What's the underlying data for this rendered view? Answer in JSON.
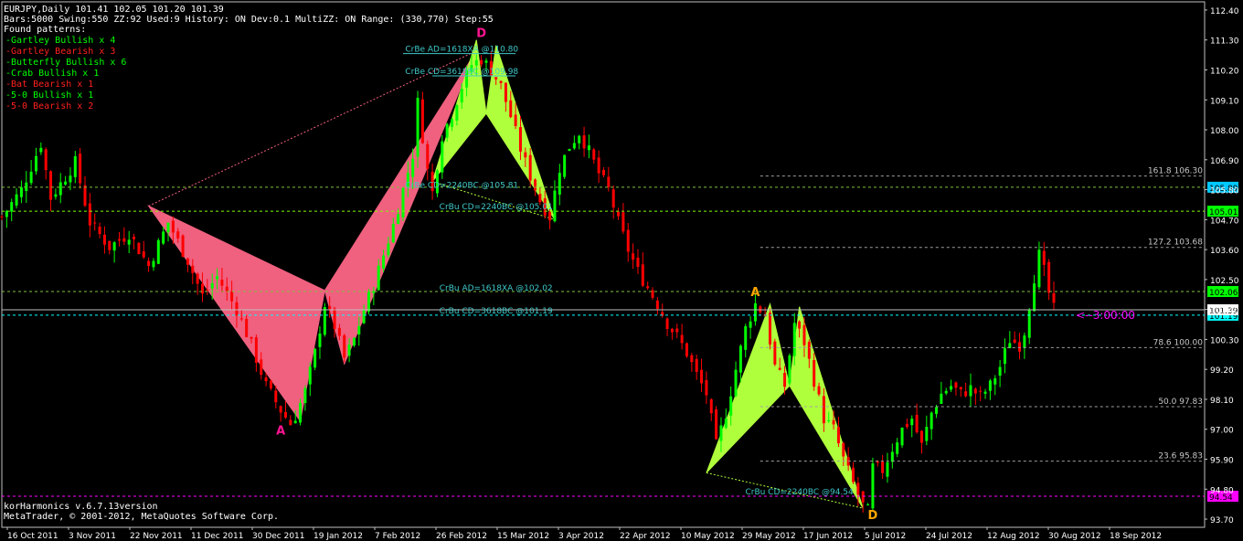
{
  "header": {
    "line1": "EURJPY,Daily  101.41 102.05 101.20 101.39",
    "line2": "Bars:5000  Swing:550  ZZ:92  Used:9  History: ON Dev:0.1  MultiZZ: ON  Range: (330,770)  Step:55",
    "found_label": "Found patterns:",
    "patterns": [
      {
        "text": "-Gartley Bullish x 4",
        "color": "#00ff00"
      },
      {
        "text": "-Gartley Bearish x 3",
        "color": "#ff2020"
      },
      {
        "text": "-Butterfly Bullish x 6",
        "color": "#00ff00"
      },
      {
        "text": "-Crab Bullish x 1",
        "color": "#00ff00"
      },
      {
        "text": "-Bat Bearish x 1",
        "color": "#ff2020"
      },
      {
        "text": "-5-0 Bullish x 1",
        "color": "#00ff00"
      },
      {
        "text": "-5-0 Bearish x 2",
        "color": "#ff2020"
      }
    ]
  },
  "footer": {
    "version": "korHarmonics v.6.7.13version",
    "copyright": "MetaTrader, © 2001-2012, MetaQuotes Software Corp."
  },
  "chart_data": {
    "type": "candlestick",
    "symbol": "EURJPY",
    "timeframe": "Daily",
    "y_ticks": [
      112.4,
      111.3,
      110.2,
      109.1,
      108.0,
      106.9,
      105.8,
      104.7,
      103.6,
      102.5,
      101.4,
      100.3,
      99.2,
      98.1,
      97.0,
      95.9,
      94.8,
      93.7
    ],
    "ylim": [
      93.4,
      112.7
    ],
    "x_ticks": [
      "16 Oct 2011",
      "3 Nov 2011",
      "22 Nov 2011",
      "11 Dec 2011",
      "30 Dec 2011",
      "19 Jan 2012",
      "7 Feb 2012",
      "26 Feb 2012",
      "15 Mar 2012",
      "3 Apr 2012",
      "22 Apr 2012",
      "10 May 2012",
      "29 May 2012",
      "17 Jun 2012",
      "5 Jul 2012",
      "24 Jul 2012",
      "12 Aug 2012",
      "30 Aug 2012",
      "18 Sep 2012"
    ],
    "close_path": [
      [
        0,
        104.8
      ],
      [
        4,
        105.8
      ],
      [
        8,
        107.5
      ],
      [
        10,
        105.5
      ],
      [
        15,
        106.8
      ],
      [
        18,
        104.6
      ],
      [
        22,
        103.7
      ],
      [
        26,
        104.2
      ],
      [
        30,
        103.0
      ],
      [
        34,
        104.6
      ],
      [
        38,
        103.2
      ],
      [
        41,
        101.9
      ],
      [
        44,
        102.6
      ],
      [
        48,
        101.4
      ],
      [
        51,
        100.1
      ],
      [
        54,
        98.6
      ],
      [
        57,
        97.7
      ],
      [
        59,
        97.2
      ],
      [
        60,
        97.5
      ],
      [
        62,
        98.4
      ],
      [
        64,
        99.8
      ],
      [
        66,
        101.6
      ],
      [
        68,
        100.8
      ],
      [
        70,
        99.6
      ],
      [
        72,
        100.3
      ],
      [
        74,
        101.4
      ],
      [
        76,
        102.3
      ],
      [
        78,
        103.4
      ],
      [
        80,
        104.5
      ],
      [
        82,
        105.8
      ],
      [
        84,
        107.1
      ],
      [
        85,
        109.0
      ],
      [
        87,
        106.5
      ],
      [
        88,
        105.7
      ],
      [
        90,
        107.8
      ],
      [
        92,
        108.6
      ],
      [
        94,
        109.6
      ],
      [
        96,
        110.4
      ],
      [
        98,
        110.6
      ],
      [
        100,
        110.2
      ],
      [
        102,
        109.6
      ],
      [
        104,
        108.5
      ],
      [
        106,
        107.3
      ],
      [
        108,
        106.3
      ],
      [
        110,
        105.4
      ],
      [
        112,
        104.8
      ],
      [
        114,
        106.6
      ],
      [
        116,
        107.4
      ],
      [
        118,
        107.9
      ],
      [
        120,
        107.2
      ],
      [
        122,
        106.4
      ],
      [
        124,
        105.8
      ],
      [
        126,
        104.6
      ],
      [
        128,
        103.6
      ],
      [
        130,
        102.8
      ],
      [
        132,
        102.2
      ],
      [
        134,
        101.6
      ],
      [
        136,
        100.9
      ],
      [
        138,
        100.4
      ],
      [
        140,
        99.8
      ],
      [
        142,
        99.0
      ],
      [
        144,
        98.3
      ],
      [
        146,
        96.4
      ],
      [
        148,
        97.6
      ],
      [
        150,
        99.2
      ],
      [
        152,
        100.7
      ],
      [
        154,
        101.6
      ],
      [
        156,
        101.2
      ],
      [
        158,
        99.3
      ],
      [
        160,
        98.6
      ],
      [
        162,
        100.9
      ],
      [
        164,
        100.2
      ],
      [
        166,
        98.8
      ],
      [
        168,
        97.4
      ],
      [
        170,
        97.0
      ],
      [
        172,
        95.9
      ],
      [
        174,
        95.0
      ],
      [
        176,
        94.2
      ],
      [
        177,
        94.0
      ],
      [
        178,
        95.6
      ],
      [
        180,
        95.5
      ],
      [
        182,
        96.3
      ],
      [
        184,
        97.0
      ],
      [
        186,
        97.4
      ],
      [
        188,
        96.4
      ],
      [
        190,
        97.6
      ],
      [
        192,
        98.3
      ],
      [
        194,
        98.6
      ],
      [
        196,
        98.3
      ],
      [
        198,
        98.5
      ],
      [
        200,
        98.2
      ],
      [
        202,
        98.6
      ],
      [
        204,
        99.3
      ],
      [
        206,
        100.3
      ],
      [
        208,
        100.1
      ],
      [
        209,
        100.6
      ],
      [
        210,
        101.6
      ],
      [
        211,
        102.6
      ],
      [
        212,
        103.4
      ],
      [
        213,
        102.8
      ],
      [
        214,
        102.0
      ],
      [
        215,
        101.4
      ]
    ],
    "harmonic_patterns": [
      {
        "name": "bearish-bat",
        "color": "#f0607f",
        "x": [
          30,
          61,
          66,
          70,
          97
        ],
        "y": [
          105.2,
          97.3,
          102.1,
          99.4,
          110.9
        ]
      },
      {
        "name": "bearish-crab",
        "color": "#b0ff3c",
        "x": [
          88,
          97,
          99,
          101,
          113
        ],
        "y": [
          106.1,
          111.3,
          108.6,
          111.1,
          104.7
        ]
      },
      {
        "name": "bullish-pattern",
        "color": "#b0ff3c",
        "x": [
          144,
          157,
          161,
          163,
          176
        ],
        "y": [
          95.4,
          101.6,
          98.6,
          101.5,
          94.1
        ]
      }
    ],
    "point_labels": [
      {
        "text": "D",
        "x": 98,
        "y": 111.4,
        "color": "#ff1493"
      },
      {
        "text": "A",
        "x": 57,
        "y": 96.8,
        "color": "#ff1493"
      },
      {
        "text": "A",
        "x": 154,
        "y": 101.9,
        "color": "#ffa500"
      },
      {
        "text": "D",
        "x": 178,
        "y": 93.7,
        "color": "#ffa500"
      }
    ],
    "levels": [
      {
        "y": 105.89,
        "label": "",
        "color": "#7fbf3f",
        "marker": "105.89",
        "marker_bg": "#00c8ff"
      },
      {
        "y": 105.01,
        "label": "",
        "color": "#7fff00",
        "marker": "105.01",
        "marker_bg": "#00ff00"
      },
      {
        "y": 102.06,
        "label": "",
        "color": "#7fbf3f",
        "marker": "102.06",
        "marker_bg": "#00ff00"
      },
      {
        "y": 101.19,
        "label": "",
        "color": "#00ffff",
        "marker": "101.19",
        "marker_bg": "#00ffff"
      },
      {
        "y": 94.54,
        "label": "",
        "color": "#ff00ff",
        "marker": "94.54",
        "marker_bg": "#ff00ff"
      }
    ],
    "fib_levels": [
      {
        "y": 106.3,
        "label": "161.8  106.30"
      },
      {
        "y": 103.68,
        "label": "127.2  103.68"
      },
      {
        "y": 100.0,
        "label": "78.6  100.00"
      },
      {
        "y": 97.83,
        "label": "50.0  97.83"
      },
      {
        "y": 95.83,
        "label": "23.6  95.83"
      }
    ],
    "pattern_labels": [
      {
        "text": "CrBe AD=1618XA   @110.80",
        "x": 94,
        "y": 110.8,
        "x0": 82,
        "x1": 105
      },
      {
        "text": "CrBe CD=3618BC   @109.98",
        "x": 94,
        "y": 109.98,
        "x0": 88,
        "x1": 105
      },
      {
        "text": "CrBe CD=2240BC   @105.81",
        "x": 94,
        "y": 105.81,
        "x0": 0,
        "x1": 0
      },
      {
        "text": "CrBu CD=2240BC   @105.01",
        "x": 101,
        "y": 105.01,
        "x0": 0,
        "x1": 0
      },
      {
        "text": "CrBu AD=1618XA   @102.02",
        "x": 101,
        "y": 102.02,
        "x0": 0,
        "x1": 0
      },
      {
        "text": "CrBu CD=3618BC   @101.19",
        "x": 101,
        "y": 101.19,
        "x0": 0,
        "x1": 0
      },
      {
        "text": "CrBu CD=2240BC   @94.54",
        "x": 163,
        "y": 94.54,
        "x0": 0,
        "x1": 0
      }
    ],
    "last_price": "101.39",
    "countdown": "<--3:00:00"
  }
}
